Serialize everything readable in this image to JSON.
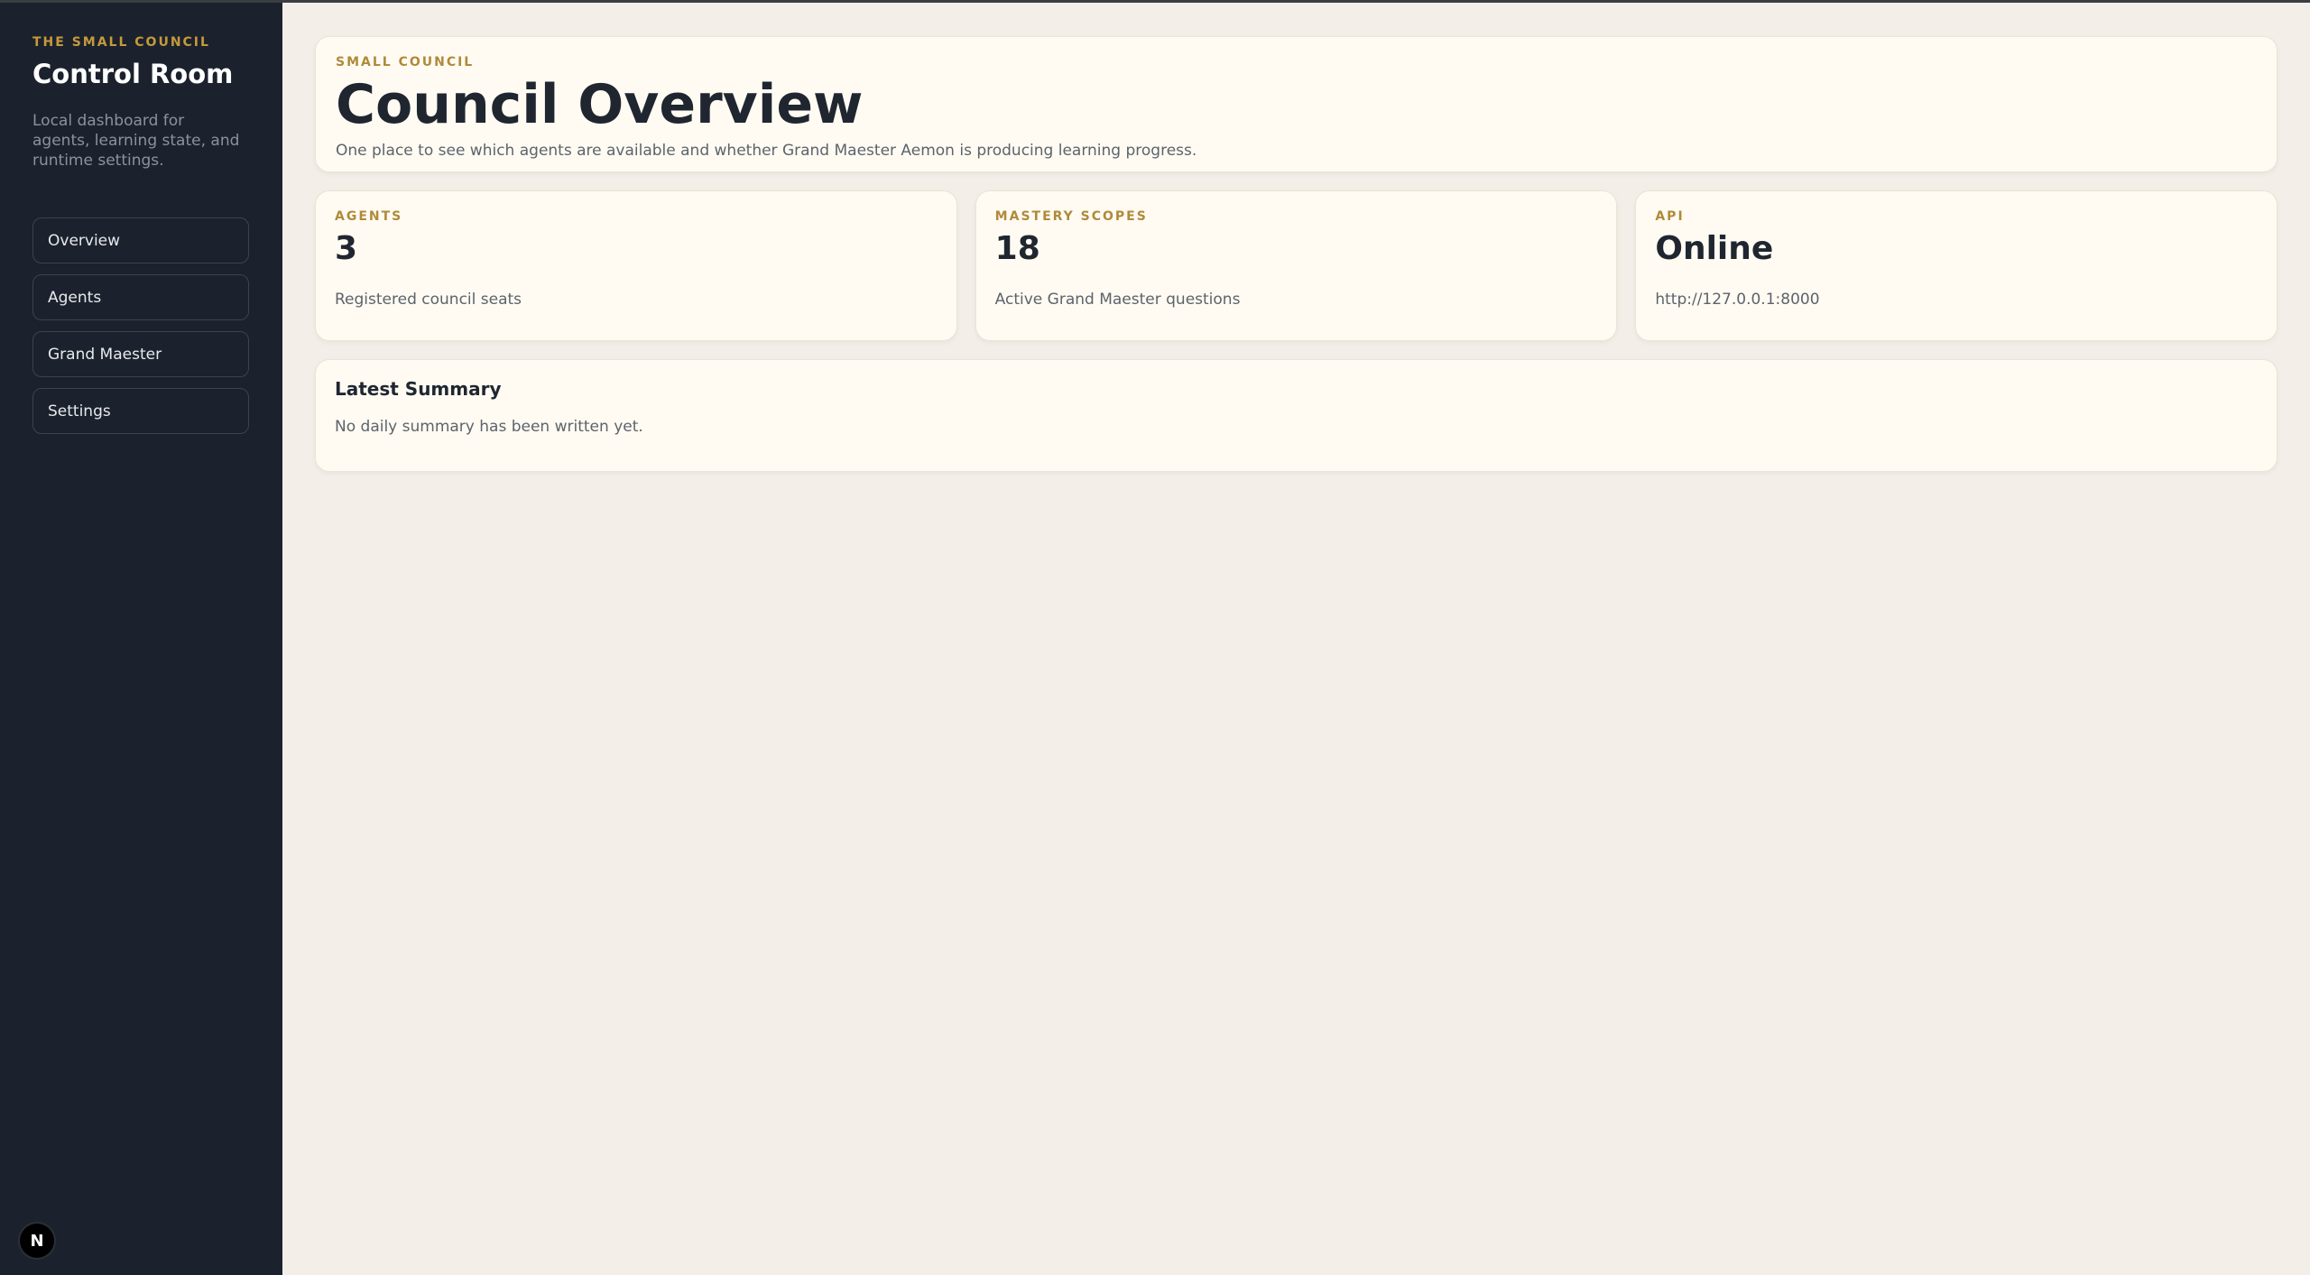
{
  "sidebar": {
    "eyebrow": "THE SMALL COUNCIL",
    "title": "Control Room",
    "description": "Local dashboard for agents, learning state, and runtime settings.",
    "nav": [
      {
        "label": "Overview"
      },
      {
        "label": "Agents"
      },
      {
        "label": "Grand Maester"
      },
      {
        "label": "Settings"
      }
    ],
    "badge": "N"
  },
  "hero": {
    "eyebrow": "SMALL COUNCIL",
    "title": "Council Overview",
    "subtitle": "One place to see which agents are available and whether Grand Maester Aemon is producing learning progress."
  },
  "stats": [
    {
      "label": "AGENTS",
      "value": "3",
      "sub": "Registered council seats"
    },
    {
      "label": "MASTERY SCOPES",
      "value": "18",
      "sub": "Active Grand Maester questions"
    },
    {
      "label": "API",
      "value": "Online",
      "sub": "http://127.0.0.1:8000"
    }
  ],
  "summary": {
    "title": "Latest Summary",
    "text": "No daily summary has been written yet."
  },
  "colors": {
    "sidebar_bg": "#1b222d",
    "page_bg": "#f3efe8",
    "card_bg": "#fffbf2",
    "accent": "#c59a3b"
  }
}
